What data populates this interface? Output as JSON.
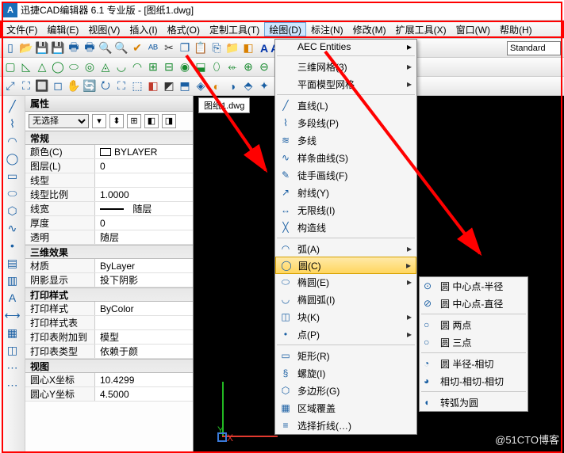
{
  "title": "迅捷CAD编辑器 6.1 专业版 - [图纸1.dwg]",
  "menubar": {
    "file": "文件(F)",
    "edit": "编辑(E)",
    "view": "视图(V)",
    "insert": "插入(I)",
    "format": "格式(O)",
    "customize": "定制工具(T)",
    "draw": "绘图(D)",
    "annotate": "标注(N)",
    "modify": "修改(M)",
    "extend": "扩展工具(X)",
    "window": "窗口(W)",
    "help": "帮助(H)"
  },
  "font_combo": "Standard",
  "canvas_tab": "图纸1.dwg",
  "axes": {
    "x": "X",
    "y": "Y"
  },
  "palette": {
    "title": "属性",
    "selector": "无选择",
    "groups": {
      "general": "常规",
      "rows_general": {
        "color_k": "颜色(C)",
        "color_v": "BYLAYER",
        "layer_k": "图层(L)",
        "layer_v": "0",
        "ltype_k": "线型",
        "ltype_v": "",
        "ltscale_k": "线型比例",
        "ltscale_v": "1.0000",
        "lweight_k": "线宽",
        "lweight_v": "随层",
        "thick_k": "厚度",
        "thick_v": "0",
        "trans_k": "透明",
        "trans_v": "随层"
      },
      "d3": "三维效果",
      "rows_d3": {
        "mat_k": "材质",
        "mat_v": "ByLayer",
        "shadow_k": "阴影显示",
        "shadow_v": "投下阴影"
      },
      "print": "打印样式",
      "rows_print": {
        "ps_k": "打印样式",
        "ps_v": "ByColor",
        "pst_k": "打印样式表",
        "pst_v": "",
        "psa_k": "打印表附加到",
        "psa_v": "模型",
        "pstp_k": "打印表类型",
        "pstp_v": "依赖于颜"
      },
      "viewg": "视图",
      "rows_view": {
        "cx_k": "圆心X坐标",
        "cx_v": "10.4299",
        "cy_k": "圆心Y坐标",
        "cy_v": "4.5000"
      }
    }
  },
  "draw_menu": {
    "aec": "AEC Entities",
    "mesh3d": "三维网格(3)",
    "flatmodel": "平面模型网格",
    "line": "直线(L)",
    "polyline": "多段线(P)",
    "multiline": "多线",
    "spline": "样条曲线(S)",
    "freehand": "徒手画线(F)",
    "ray": "射线(Y)",
    "infline": "无限线(I)",
    "cline": "构造线",
    "arc": "弧(A)",
    "circle": "圆(C)",
    "ellipse": "椭圆(E)",
    "ellarc": "椭圆弧(I)",
    "block": "块(K)",
    "point": "点(P)",
    "rect": "矩形(R)",
    "spiral": "螺旋(I)",
    "polygon": "多边形(G)",
    "region": "区域覆盖",
    "extras": "选择折线(…)"
  },
  "circle_submenu": {
    "cr": "圆 中心点-半径",
    "cd": "圆 中心点-直径",
    "p2": "圆 两点",
    "p3": "圆 三点",
    "rt": "圆 半径-相切",
    "ttt": "相切-相切-相切",
    "arc2c": "转弧为圆"
  },
  "watermark": "@51CTO博客"
}
